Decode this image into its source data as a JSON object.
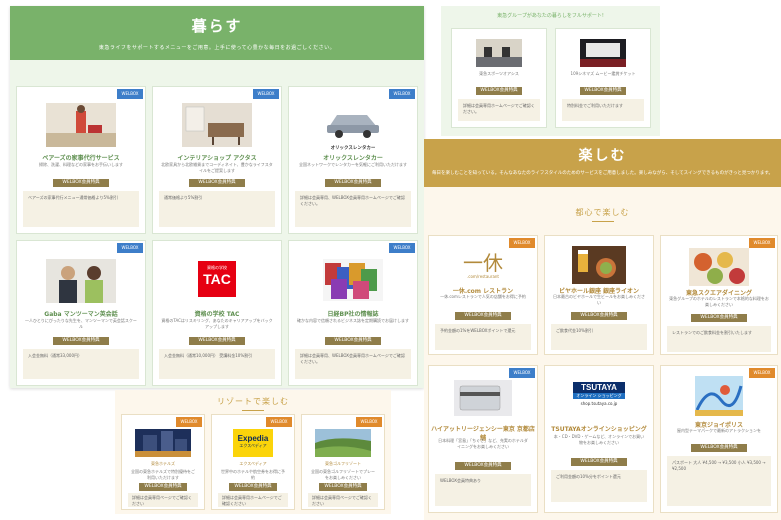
{
  "kurasu": {
    "title": "暮らす",
    "subtitle": "東急ライフをサポートするメニューをご用意。上手に使って心豊かな毎日をお過ごしください。",
    "cards": [
      {
        "title": "ベアーズの家事代行サービス",
        "desc": "掃除、洗濯、料理などの家事をお手伝いします",
        "welbox": "WELBOX会員特典",
        "note": "ベアーズの家事代行メニュー通常価格より5%割引",
        "badge": "WELBOX"
      },
      {
        "title": "インテリアショップ アクタス",
        "desc": "北欧家具から北欧雑貨までコーディネイト、豊かなライフスタイルをご提案します",
        "welbox": "WELBOX会員特典",
        "note": "通常価格より5%割引",
        "badge": "WELBOX"
      },
      {
        "title": "オリックスレンタカー",
        "desc": "全国ネットワークでレンタカーを気軽にご利用いただけます",
        "welbox": "WELBOX会員特典",
        "note": "詳細は会員専用、WELBOX会員専用ホームページでご確認ください。",
        "badge": "WELBOX"
      },
      {
        "title": "Gaba マンツーマン英会話",
        "desc": "一人ひとりにぴったりな先生を、マンツーマンで英会話スクール",
        "welbox": "WELBOX会員特典",
        "note": "入会金無料（通常33,000円）",
        "badge": "WELBOX"
      },
      {
        "title": "資格の学校 TAC",
        "desc": "資格のTACはリスキリング、あなたのキャリアアップをバックアップします",
        "welbox": "WELBOX会員特典",
        "note": "入会金無料（通常10,000円） 受講料金10%割引",
        "badge": "WELBOX"
      },
      {
        "title": "日経BP社の情報誌",
        "desc": "確かな内容で信頼されるビジネス誌を定期購読でお届けします",
        "welbox": "WELBOX会員特典",
        "note": "詳細は会員専用、WELBOX会員専用ホームページでご確認ください。",
        "badge": "WELBOX"
      }
    ]
  },
  "top_panel": {
    "heading": "東急グループがあなたの暮らしをフルサポート!",
    "cards": [
      {
        "title": "東急スポーツオアシス",
        "welbox": "WELBOX会員特典",
        "note": "詳細は会員専用ホームページでご確認ください。"
      },
      {
        "title": "109シネマズ ムービー鑑賞チケット",
        "welbox": "WELBOX会員特典",
        "note": "特別料金でご利用いただけます"
      }
    ]
  },
  "tanoshimu": {
    "title": "楽しむ",
    "subtitle": "毎日を楽しむことを知っている。そんなあなたのライフスタイルのためのサービスをご用意しました。楽しみながら、そしてスイングできるものがきっと見つかります。",
    "section": "都心で楽しむ",
    "cards": [
      {
        "title": "一休.com レストラン",
        "desc": "一休.comレストランで人気の店舗をお得に予約",
        "welbox": "WELBOX会員特典",
        "note": "予約金額の1%をWELBOXポイントで還元",
        "logo": "一休",
        "logo_sub": ".com/restaurant"
      },
      {
        "title": "ビヤホール銀座 銀座ライオン",
        "desc": "日本最古のビヤホールで生ビールをお楽しみください",
        "welbox": "WELBOX会員特典",
        "note": "ご飲食代金10%割引"
      },
      {
        "title": "東急スクエアダイニング",
        "desc": "東急グループのホテルのレストランで本格的な料理をお楽しみください",
        "welbox": "WELBOX会員特典",
        "note": "レストランでのご飲食料金を割引いたします"
      },
      {
        "title": "ハイアットリージェンシー東京 京都店舗",
        "desc": "日本料理「宮島」「ちぐさ」など、充実のホテルダイニングをお楽しみください",
        "welbox": "WELBOX会員特典",
        "note": "WELBOX会員特典あり"
      },
      {
        "title": "TSUTAYAオンラインショッピング",
        "desc": "本・CD・DVD・ゲームなど、オンラインでお買い物をお楽しみください",
        "welbox": "WELBOX会員特典",
        "note": "ご利用金額の10%分をポイント還元",
        "logo": "TSUTAYA",
        "logo_sub": "オンライン ショッピング",
        "logo_url": "shop.tsutaya.co.jp"
      },
      {
        "title": "東京ジョイポリス",
        "desc": "屋内型テーマパークで最新のアトラクションを",
        "welbox": "WELBOX会員特典",
        "note": "パスポート 大人 ¥4,500 → ¥3,500 小人 ¥3,500 → ¥2,500"
      }
    ]
  },
  "resort": {
    "section": "リゾートで楽しむ",
    "cards": [
      {
        "title": "東急ホテルズ",
        "desc": "全国の東急ホテルズで特別優待をご利用いただけます",
        "welbox": "WELBOX会員特典",
        "note": "詳細は会員専用ページでご確認ください"
      },
      {
        "title": "エクスペディア",
        "desc": "世界中のホテルや航空券をお得に予約",
        "welbox": "WELBOX会員特典",
        "note": "詳細は会員専用ホームページでご確認ください",
        "logo": "Expedia",
        "logo_sub": "エクスペディア"
      },
      {
        "title": "東急ゴルフリゾート",
        "desc": "全国の東急ゴルフリゾートでプレーをお楽しみください",
        "welbox": "WELBOX会員特典",
        "note": "詳細は会員専用ページでご確認ください"
      }
    ]
  },
  "logos": {
    "orix": "オリックスレンタカー",
    "tac_top": "資格の学校",
    "tac": "TAC"
  }
}
